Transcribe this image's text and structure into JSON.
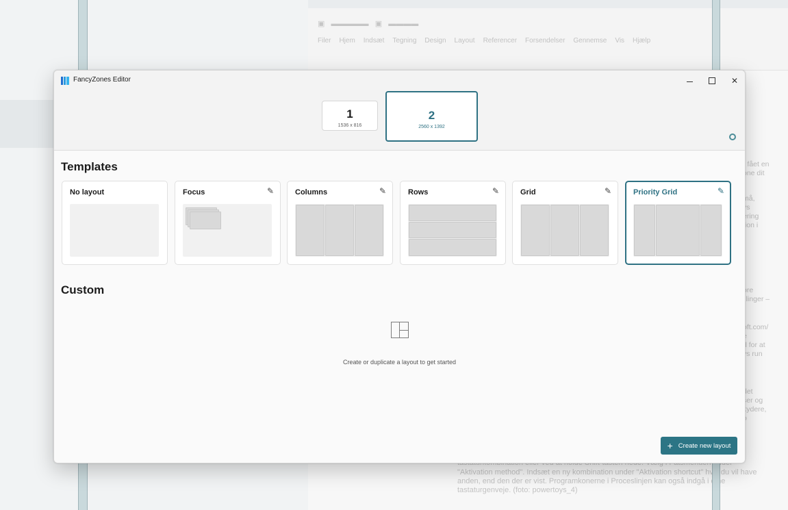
{
  "window": {
    "app_title": "FancyZones Editor",
    "app_icon": "fancyzones-icon",
    "controls": {
      "minimize": "—",
      "maximize": "☐",
      "close": "✕"
    }
  },
  "monitors": [
    {
      "number": "1",
      "resolution": "1536 x 816",
      "selected": false
    },
    {
      "number": "2",
      "resolution": "2560 x 1392",
      "selected": true
    }
  ],
  "settings_icon": "gear-icon",
  "templates": {
    "title": "Templates",
    "items": [
      {
        "name": "No layout",
        "editable": false,
        "selected": false
      },
      {
        "name": "Focus",
        "editable": true,
        "selected": false
      },
      {
        "name": "Columns",
        "editable": true,
        "selected": false
      },
      {
        "name": "Rows",
        "editable": true,
        "selected": false
      },
      {
        "name": "Grid",
        "editable": true,
        "selected": false
      },
      {
        "name": "Priority Grid",
        "editable": true,
        "selected": true
      }
    ]
  },
  "custom": {
    "title": "Custom",
    "empty_icon": "layout-grid-icon",
    "empty_text": "Create or duplicate a layout to get started"
  },
  "create_button": {
    "icon": "+",
    "label": "Create new layout"
  },
  "colors": {
    "accent": "#2e7183",
    "button": "#2c7585",
    "zone": "#d9d9d9"
  }
}
